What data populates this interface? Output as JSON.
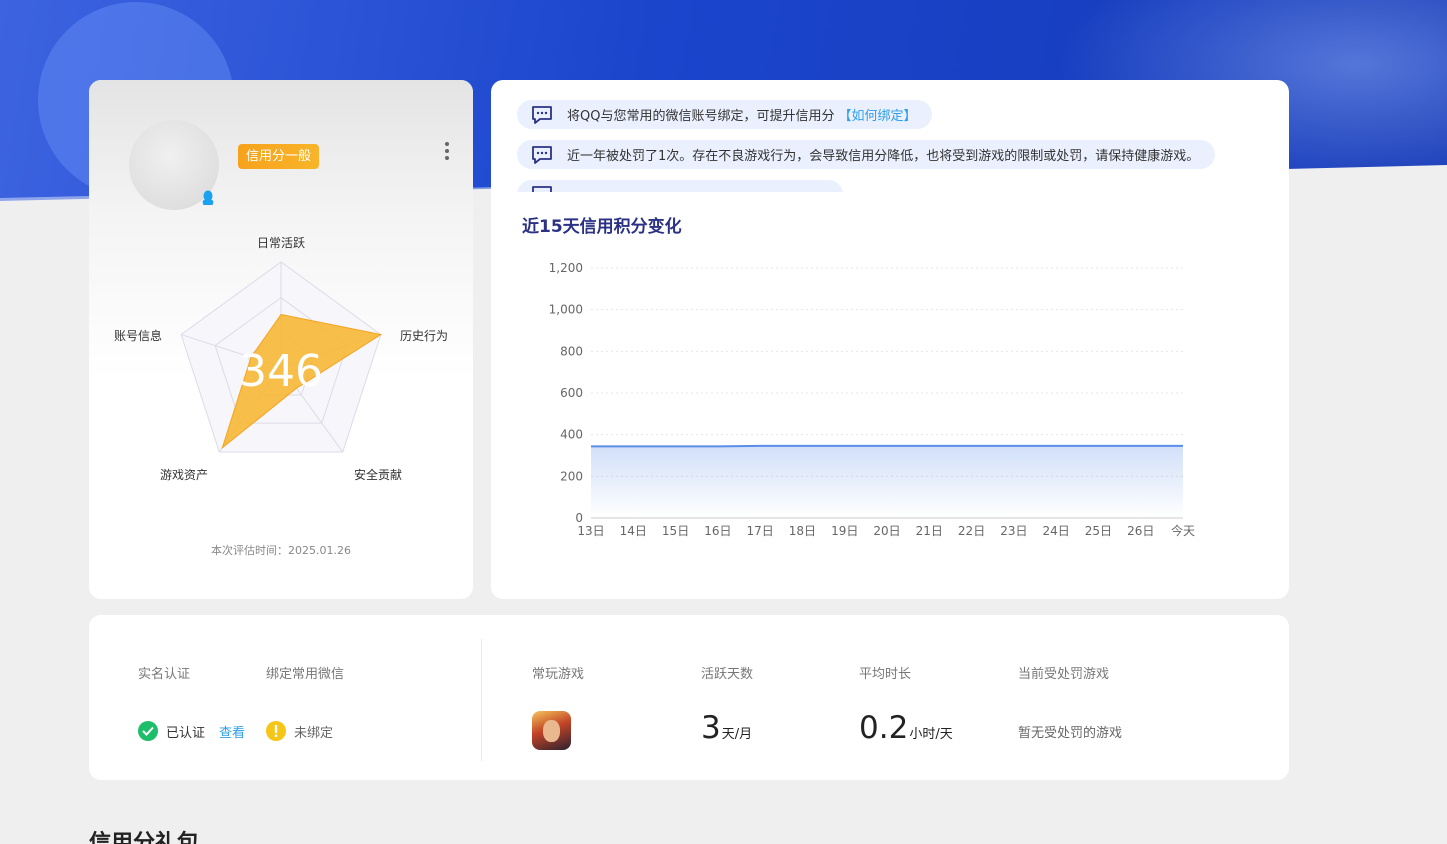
{
  "profile": {
    "credit_badge": "信用分一般",
    "score": "346",
    "eval_time": "本次评估时间：2025.01.26",
    "radar_axes": [
      "日常活跃",
      "历史行为",
      "安全贡献",
      "游戏资产",
      "账号信息"
    ],
    "radar_values": [
      0.5,
      1.0,
      0.25,
      0.95,
      0.3
    ]
  },
  "notices": [
    {
      "text": "将QQ与您常用的微信账号绑定，可提升信用分",
      "link": "【如何绑定】"
    },
    {
      "text": "近一年被处罚了1次。存在不良游戏行为，会导致信用分降低，也将受到游戏的限制或处罚，请保持健康游戏。",
      "link": ""
    }
  ],
  "chart_title": "近15天信用积分变化",
  "chart_data": {
    "type": "area",
    "title": "近15天信用积分变化",
    "xlabel": "",
    "ylabel": "",
    "categories": [
      "13日",
      "14日",
      "15日",
      "16日",
      "17日",
      "18日",
      "19日",
      "20日",
      "21日",
      "22日",
      "23日",
      "24日",
      "25日",
      "26日",
      "今天"
    ],
    "values": [
      344,
      344,
      344,
      344,
      346,
      346,
      346,
      346,
      346,
      346,
      346,
      346,
      346,
      346,
      346
    ],
    "ylim": [
      0,
      1200
    ],
    "yticks": [
      "0",
      "200",
      "400",
      "600",
      "800",
      "1,000",
      "1,200"
    ],
    "grid": true,
    "color": "#5b8ee8"
  },
  "bottom": {
    "realname_label": "实名认证",
    "wechat_label": "绑定常用微信",
    "realname_status": "已认证",
    "view_link": "查看",
    "wechat_status": "未绑定",
    "games_label": "常玩游戏",
    "active_days_label": "活跃天数",
    "active_days_value": "3",
    "active_days_unit": "天/月",
    "avg_time_label": "平均时长",
    "avg_time_value": "0.2",
    "avg_time_unit": "小时/天",
    "penalty_label": "当前受处罚游戏",
    "penalty_value": "暂无受处罚的游戏"
  },
  "section_title": "信用分礼包",
  "colors": {
    "accent": "#2b3285",
    "link": "#2d9ee8",
    "badge": "#f7a21c",
    "radar_fill": "#f7b52a",
    "ok": "#1ebd6a",
    "warn": "#f5c518"
  }
}
